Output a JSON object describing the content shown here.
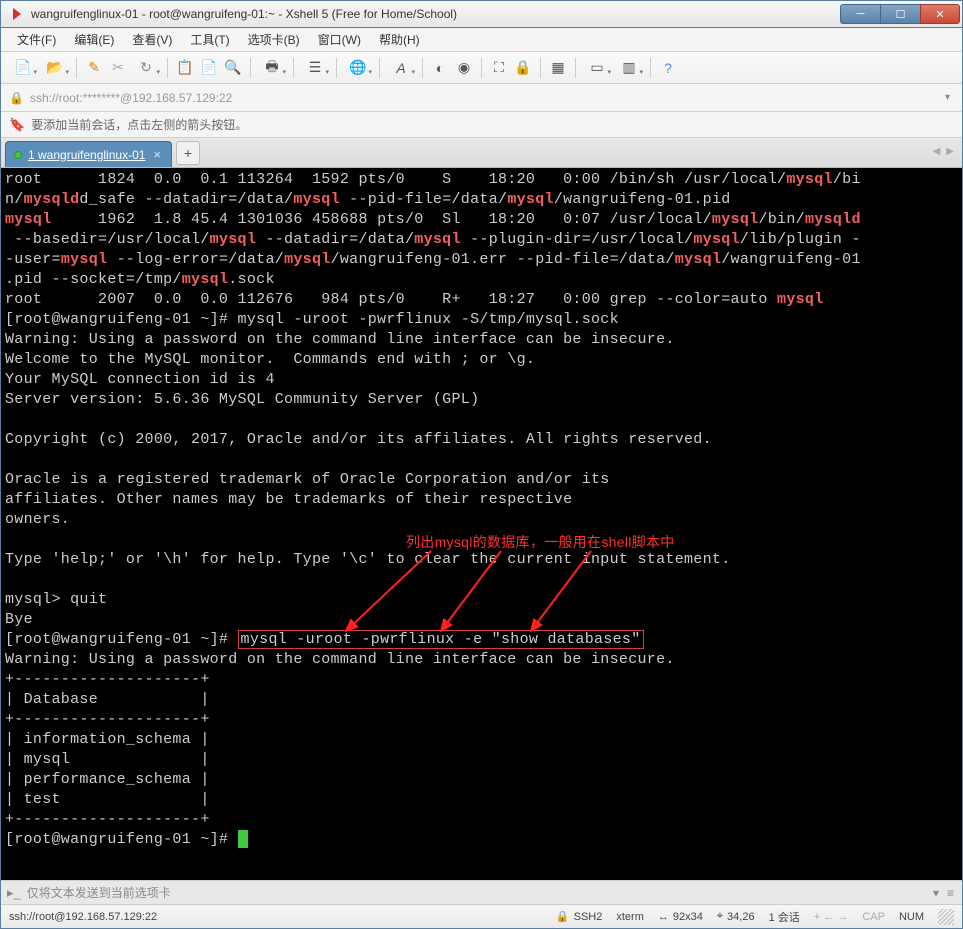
{
  "window": {
    "title": "wangruifenglinux-01 - root@wangruifeng-01:~ - Xshell 5 (Free for Home/School)"
  },
  "menu": {
    "file": "文件(F)",
    "edit": "编辑(E)",
    "view": "查看(V)",
    "tools": "工具(T)",
    "tabs": "选项卡(B)",
    "window": "窗口(W)",
    "help": "帮助(H)"
  },
  "address": {
    "text": "ssh://root:********@192.168.57.129:22"
  },
  "hint": {
    "text": "要添加当前会话，点击左侧的箭头按钮。"
  },
  "tab": {
    "label": "1 wangruifenglinux-01"
  },
  "annotation": {
    "text": "列出mysql的数据库，一般用在shell脚本中"
  },
  "terminal": {
    "l1a": "root      1824  0.0  0.1 113264  1592 pts/0    S    18:20   0:00 /bin/sh /usr/local/",
    "l1b": "/bi",
    "l2a": "n/",
    "l2b": "d_safe --datadir=/data/",
    "l2c": " --pid-file=/data/",
    "l2d": "/wangruifeng-01.pid",
    "l3a": "     1962  1.8 45.4 1301036 458688 pts/0  Sl   18:20   0:07 /usr/local/",
    "l3b": "/bin/",
    "l4a": " --basedir=/usr/local/",
    "l4b": " --datadir=/data/",
    "l4c": " --plugin-dir=/usr/local/",
    "l4d": "/lib/plugin -",
    "l5a": "-user=",
    "l5b": " --log-error=/data/",
    "l5c": "/wangruifeng-01.err --pid-file=/data/",
    "l5d": "/wangruifeng-01",
    "l6a": ".pid --socket=/tmp/",
    "l6b": ".sock",
    "l7a": "root      2007  0.0  0.0 112676   984 pts/0    R+   18:27   0:00 grep --color=auto ",
    "l8": "[root@wangruifeng-01 ~]# mysql -uroot -pwrflinux -S/tmp/mysql.sock",
    "l9": "Warning: Using a password on the command line interface can be insecure.",
    "l10": "Welcome to the MySQL monitor.  Commands end with ; or \\g.",
    "l11": "Your MySQL connection id is 4",
    "l12": "Server version: 5.6.36 MySQL Community Server (GPL)",
    "l13": "",
    "l14": "Copyright (c) 2000, 2017, Oracle and/or its affiliates. All rights reserved.",
    "l15": "",
    "l16": "Oracle is a registered trademark of Oracle Corporation and/or its",
    "l17": "affiliates. Other names may be trademarks of their respective",
    "l18": "owners.",
    "l19": "",
    "l20": "Type 'help;' or '\\h' for help. Type '\\c' to clear the current input statement.",
    "l21": "",
    "l22": "mysql> quit",
    "l23": "Bye",
    "l24a": "[root@wangruifeng-01 ~]# ",
    "l24b": "mysql -uroot -pwrflinux -e \"show databases\"",
    "l25": "Warning: Using a password on the command line interface can be insecure.",
    "l26": "+--------------------+",
    "l27": "| Database           |",
    "l28": "+--------------------+",
    "l29": "| information_schema |",
    "l30": "| mysql              |",
    "l31": "| performance_schema |",
    "l32": "| test               |",
    "l33": "+--------------------+",
    "l34": "[root@wangruifeng-01 ~]# ",
    "hl_mysql": "mysql",
    "hl_mysqld": "mysqld"
  },
  "bottomhint": {
    "text": "仅将文本发送到当前选项卡"
  },
  "status": {
    "conn": "ssh://root@192.168.57.129:22",
    "ssh": "SSH2",
    "term": "xterm",
    "size": "92x34",
    "pos": "34,26",
    "sessions": "1 会话",
    "cap": "CAP",
    "num": "NUM"
  }
}
